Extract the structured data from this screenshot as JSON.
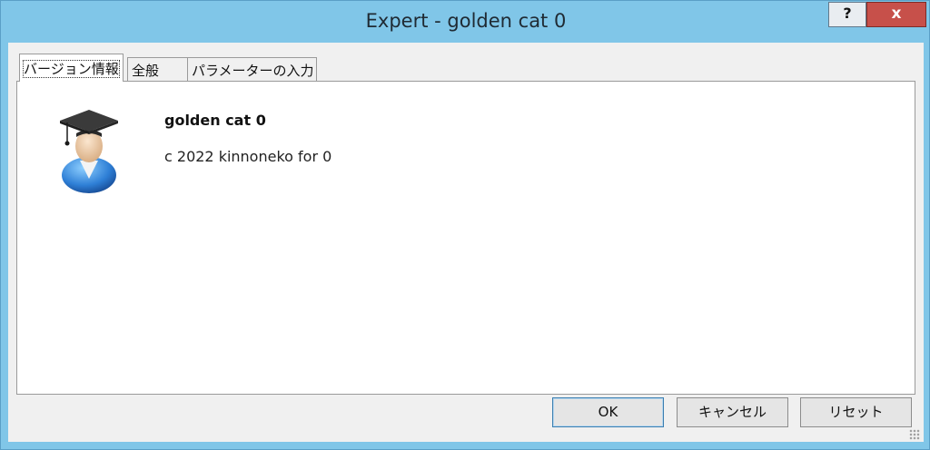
{
  "window": {
    "title": "Expert - golden cat 0"
  },
  "titlebar": {
    "help_label": "?",
    "close_label": "x"
  },
  "tabs": [
    {
      "label": "バージョン情報",
      "active": true
    },
    {
      "label": "全般",
      "active": false
    },
    {
      "label": "パラメーターの入力",
      "active": false
    }
  ],
  "about": {
    "icon": "graduate-user-icon",
    "name": "golden cat 0",
    "copyright": "c 2022 kinnoneko for 0"
  },
  "buttons": {
    "ok": "OK",
    "cancel": "キャンセル",
    "reset": "リセット"
  },
  "colors": {
    "titlebar": "#80c6e8",
    "close": "#c7504a"
  }
}
